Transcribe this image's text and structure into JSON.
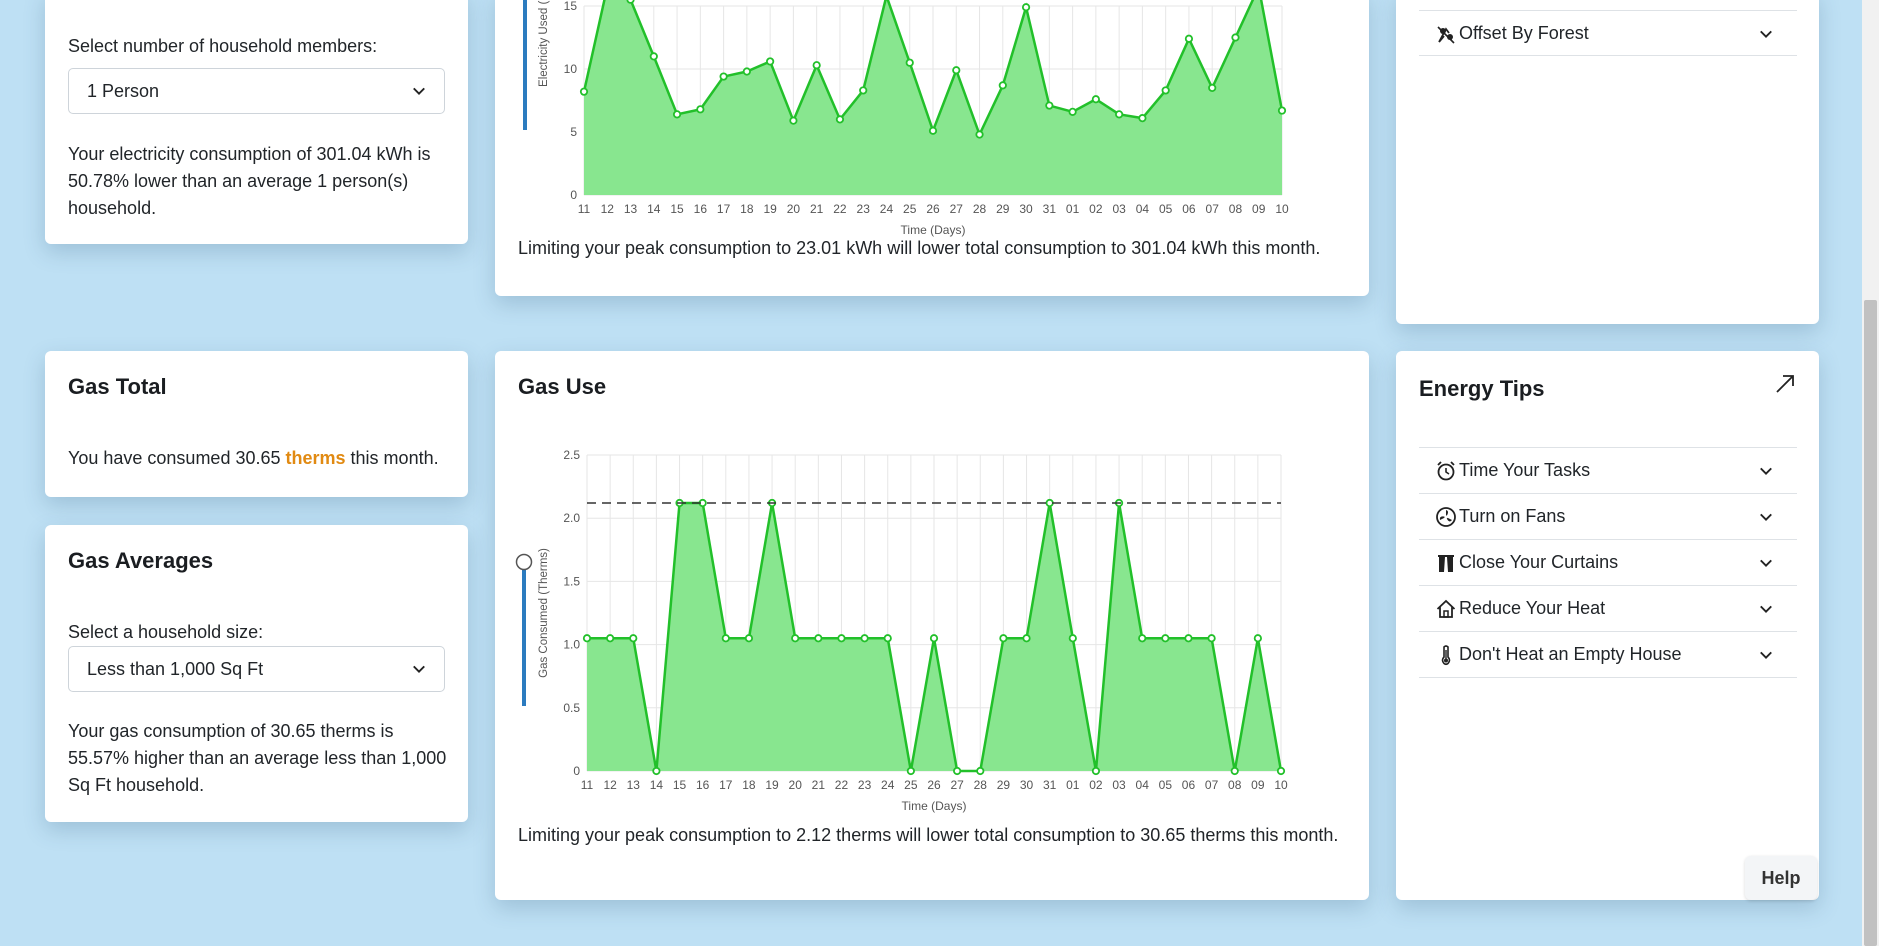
{
  "household": {
    "select_label": "Select number of household members:",
    "selected": "1 Person",
    "summary": "Your electricity consumption of 301.04 kWh is 50.78% lower than an average 1 person(s) household."
  },
  "electricity": {
    "ylabel": "Electricity Used (K",
    "xlabel": "Time (Days)",
    "summary": "Limiting your peak consumption to 23.01 kWh will lower total consumption to 301.04 kWh this month."
  },
  "offset": {
    "label": "Offset By Forest",
    "icon": "forest-icon"
  },
  "gas_total": {
    "title": "Gas Total",
    "text_before": "You have consumed 30.65 ",
    "unit": "therms",
    "text_after": " this month."
  },
  "gas_averages": {
    "title": "Gas Averages",
    "select_label": "Select a household size:",
    "selected": "Less than 1,000 Sq Ft",
    "summary": "Your gas consumption of 30.65 therms is 55.57% higher than an average less than 1,000 Sq Ft household."
  },
  "gas_use": {
    "title": "Gas Use",
    "summary": "Limiting your peak consumption to 2.12 therms will lower total consumption to 30.65 therms this month."
  },
  "energy_tips": {
    "title": "Energy Tips",
    "items": [
      {
        "label": "Time Your Tasks",
        "icon": "alarm-clock-icon"
      },
      {
        "label": "Turn on Fans",
        "icon": "fan-icon"
      },
      {
        "label": "Close Your Curtains",
        "icon": "curtains-icon"
      },
      {
        "label": "Reduce Your Heat",
        "icon": "house-icon"
      },
      {
        "label": "Don't Heat an Empty House",
        "icon": "thermometer-icon"
      }
    ]
  },
  "help_label": "Help",
  "colors": {
    "fill": "#88e68f",
    "line": "#22c02a",
    "accent": "#e18a12",
    "slider": "#2b7bbf"
  },
  "chart_data": [
    {
      "type": "area",
      "ylabel": "Electricity Used (K",
      "xlabel": "Time (Days)",
      "ylim": [
        0,
        15
      ],
      "yticks": [
        0,
        5,
        10,
        15
      ],
      "x": [
        "11",
        "12",
        "13",
        "14",
        "15",
        "16",
        "17",
        "18",
        "19",
        "20",
        "21",
        "22",
        "23",
        "24",
        "25",
        "26",
        "27",
        "28",
        "29",
        "30",
        "31",
        "01",
        "02",
        "03",
        "04",
        "05",
        "06",
        "07",
        "08",
        "09",
        "10"
      ],
      "values": [
        8.2,
        16.5,
        15.5,
        11,
        6.4,
        6.8,
        9.4,
        9.8,
        10.6,
        5.9,
        10.3,
        6.0,
        8.3,
        15.8,
        10.5,
        5.1,
        9.9,
        4.8,
        8.7,
        14.9,
        7.1,
        6.6,
        7.6,
        6.4,
        6.1,
        8.3,
        12.4,
        8.5,
        12.5,
        16.5,
        6.7
      ],
      "grid": true
    },
    {
      "type": "area",
      "ylabel": "Gas Consumed (Therms)",
      "xlabel": "Time (Days)",
      "ylim": [
        0,
        2.5
      ],
      "yticks": [
        0,
        0.5,
        1.0,
        1.5,
        2.0,
        2.5
      ],
      "threshold": 2.12,
      "x": [
        "11",
        "12",
        "13",
        "14",
        "15",
        "16",
        "17",
        "18",
        "19",
        "20",
        "21",
        "22",
        "23",
        "24",
        "25",
        "26",
        "27",
        "28",
        "29",
        "30",
        "31",
        "01",
        "02",
        "03",
        "04",
        "05",
        "06",
        "07",
        "08",
        "09",
        "10"
      ],
      "values": [
        1.05,
        1.05,
        1.05,
        0,
        2.12,
        2.12,
        1.05,
        1.05,
        2.12,
        1.05,
        1.05,
        1.05,
        1.05,
        1.05,
        0,
        1.05,
        0,
        0,
        1.05,
        1.05,
        2.12,
        1.05,
        0,
        2.12,
        1.05,
        1.05,
        1.05,
        1.05,
        0,
        1.05,
        0
      ],
      "grid": true
    }
  ]
}
